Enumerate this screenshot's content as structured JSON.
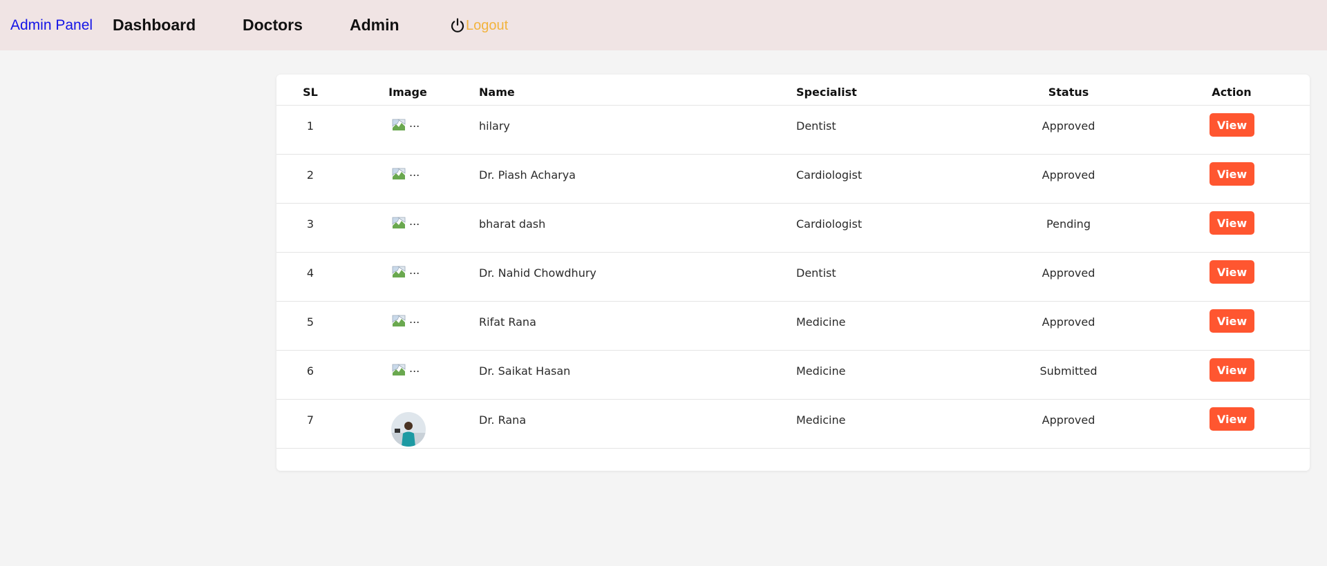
{
  "nav": {
    "brand": "Admin Panel",
    "links": [
      "Dashboard",
      "Doctors",
      "Admin"
    ],
    "logout_label": "Logout",
    "logout_icon": "power-icon"
  },
  "colors": {
    "navbar_bg": "#f0e4e4",
    "brand": "#1414e6",
    "logout": "#f2b33d",
    "view_button": "#ff5630"
  },
  "table": {
    "headers": [
      "SL",
      "Image",
      "Name",
      "Specialist",
      "Status",
      "Action"
    ],
    "rows": [
      {
        "sl": "1",
        "image": "...",
        "name": "hilary",
        "specialist": "Dentist",
        "status": "Approved",
        "action": "View"
      },
      {
        "sl": "2",
        "image": "...",
        "name": "Dr. Piash Acharya",
        "specialist": "Cardiologist",
        "status": "Approved",
        "action": "View"
      },
      {
        "sl": "3",
        "image": "...",
        "name": "bharat dash",
        "specialist": "Cardiologist",
        "status": "Pending",
        "action": "View"
      },
      {
        "sl": "4",
        "image": "...",
        "name": "Dr. Nahid Chowdhury",
        "specialist": "Dentist",
        "status": "Approved",
        "action": "View"
      },
      {
        "sl": "5",
        "image": "...",
        "name": "Rifat Rana",
        "specialist": "Medicine",
        "status": "Approved",
        "action": "View"
      },
      {
        "sl": "6",
        "image": "...",
        "name": "Dr. Saikat Hasan",
        "specialist": "Medicine",
        "status": "Submitted",
        "action": "View"
      },
      {
        "sl": "7",
        "image": "",
        "name": "Dr. Rana",
        "specialist": "Medicine",
        "status": "Approved",
        "action": "View"
      }
    ]
  }
}
